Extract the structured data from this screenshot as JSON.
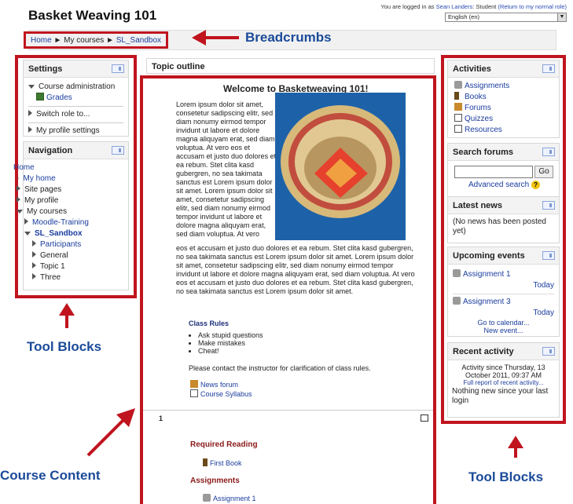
{
  "header": {
    "site_title": "Basket Weaving 101",
    "login_prefix": "You are logged in as",
    "user_name": "Sean Landers",
    "role_text": ": Student",
    "return_link": "(Return to my normal role)",
    "language": "English (en)"
  },
  "breadcrumb": {
    "home": "Home",
    "sep": "►",
    "my_courses": "My courses",
    "course": "SL_Sandbox"
  },
  "annotations": {
    "breadcrumbs": "Breadcrumbs",
    "tool_blocks_left": "Tool Blocks",
    "tool_blocks_right": "Tool Blocks",
    "course_content": "Course Content"
  },
  "settings": {
    "title": "Settings",
    "course_admin": "Course administration",
    "grades": "Grades",
    "switch_role": "Switch role to...",
    "profile_settings": "My profile settings"
  },
  "navigation": {
    "title": "Navigation",
    "home": "Home",
    "my_home": "My home",
    "site_pages": "Site pages",
    "my_profile": "My profile",
    "my_courses": "My courses",
    "moodle_training": "Moodle-Training",
    "sl_sandbox": "SL_Sandbox",
    "participants": "Participants",
    "general": "General",
    "topic1": "Topic 1",
    "three": "Three"
  },
  "main": {
    "topic_outline": "Topic outline",
    "welcome": "Welcome to Basketweaving 101!",
    "lorem_narrow": "Lorem ipsum dolor sit amet, consetetur sadipscing elitr, sed diam nonumy eirmod tempor invidunt ut labore et dolore magna aliquyam erat, sed diam voluptua. At vero eos et accusam et justo duo dolores et ea rebum. Stet clita kasd gubergren, no sea takimata sanctus est Lorem ipsum dolor sit amet. Lorem ipsum dolor sit amet, consetetur sadipscing elitr, sed diam nonumy eirmod tempor invidunt ut labore et dolore magna aliquyam erat, sed diam voluptua. At vero",
    "lorem_wide": "eos et accusam et justo duo dolores et ea rebum. Stet clita kasd gubergren, no sea takimata sanctus est Lorem ipsum dolor sit amet. Lorem ipsum dolor sit amet, consetetur sadipscing elitr, sed diam nonumy eirmod tempor invidunt ut labore et dolore magna aliquyam erat, sed diam voluptua. At vero eos et accusam et justo duo dolores et ea rebum. Stet clita kasd gubergren, no sea takimata sanctus est Lorem ipsum dolor sit amet.",
    "class_rules": "Class Rules",
    "rules": [
      "Ask stupid questions",
      "Make mistakes",
      "Cheat!"
    ],
    "contact": "Please contact the instructor for clarification of class rules.",
    "news_forum": "News forum",
    "course_syllabus": "Course Syllabus",
    "section_number": "1",
    "required_reading": "Required Reading",
    "first_book": "First Book",
    "assignments": "Assignments",
    "assignment1": "Assignment 1"
  },
  "activities": {
    "title": "Activities",
    "items": [
      "Assignments",
      "Books",
      "Forums",
      "Quizzes",
      "Resources"
    ]
  },
  "search_forums": {
    "title": "Search forums",
    "input_value": "",
    "go": "Go",
    "advanced": "Advanced search"
  },
  "latest_news": {
    "title": "Latest news",
    "text": "(No news has been posted yet)"
  },
  "upcoming": {
    "title": "Upcoming events",
    "event1": "Assignment 1",
    "event1_when": "Today",
    "event2": "Assignment 3",
    "event2_when": "Today",
    "calendar": "Go to calendar...",
    "new_event": "New event..."
  },
  "recent": {
    "title": "Recent activity",
    "since": "Activity since Thursday, 13 October 2011, 09:37 AM",
    "full_report": "Full report of recent activity...",
    "nothing": "Nothing new since your last login"
  }
}
